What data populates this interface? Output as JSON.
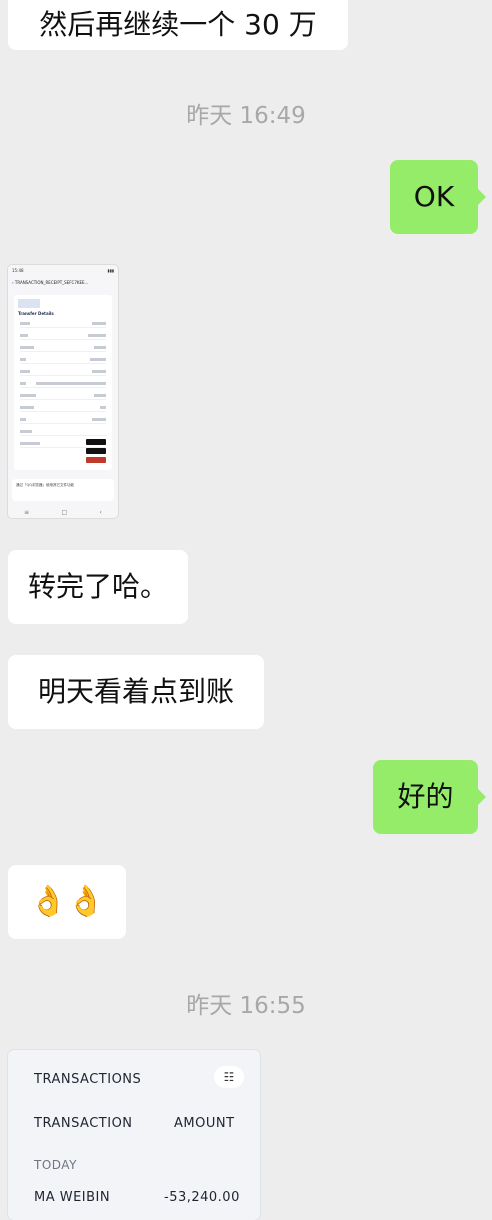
{
  "messages": {
    "m1": "然后再继续一个 30 万",
    "m2": "OK",
    "m3": "转完了哈。",
    "m4": "明天看着点到账",
    "m5": "好的",
    "m6": "👌👌"
  },
  "timestamps": {
    "t1": "昨天 16:49",
    "t2": "昨天 16:55"
  },
  "receipt_image": {
    "status_time": "15:48",
    "title": "TRANSACTION_RECEIPT_SEFC7KEE...",
    "sheet_title": "Transfer Details",
    "share_text": "通过「QQ浏览器」使用其它文件功能"
  },
  "transactions_card": {
    "header": "TRANSACTIONS",
    "col_transaction": "TRANSACTION",
    "col_amount": "AMOUNT",
    "section": "TODAY",
    "row_name": "MA WEIBIN",
    "row_amount": "-53,240.00"
  }
}
